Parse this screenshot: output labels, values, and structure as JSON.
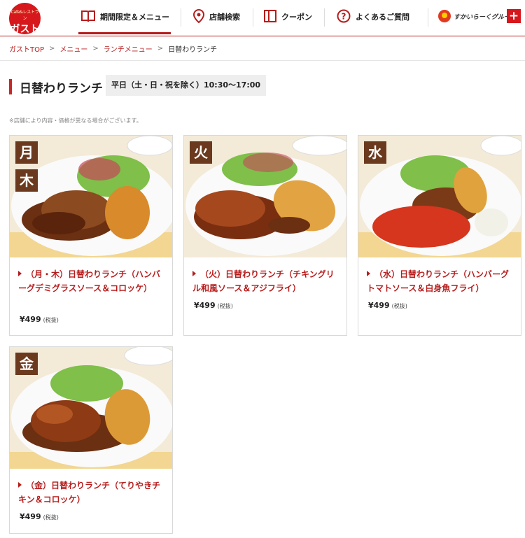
{
  "header": {
    "logo_sub": "Cafe&レストラン",
    "logo_main": "ガスト",
    "nav": [
      {
        "label": "期間限定＆メニュー",
        "icon": "book-icon"
      },
      {
        "label": "店舗検索",
        "icon": "map-pin-icon"
      },
      {
        "label": "クーポン",
        "icon": "coupon-icon"
      },
      {
        "label": "よくあるご質問",
        "icon": "question-icon"
      }
    ],
    "group_logo": "すかいらーくグループ",
    "plus_label": "+"
  },
  "breadcrumb": [
    "ガストTOP",
    "メニュー",
    "ランチメニュー",
    "日替わりランチ"
  ],
  "breadcrumb_sep": ">",
  "page": {
    "title": "日替わりランチ",
    "hours": "平日（土・日・祝を除く）10:30〜17:00",
    "notice": "※店舗により内容・価格が異なる場合がございます。"
  },
  "items": [
    {
      "days": [
        "月",
        "木"
      ],
      "name": "（月・木）日替わりランチ（ハンバーグデミグラスソース＆コロッケ）",
      "price": "¥499",
      "tax": "(税抜)"
    },
    {
      "days": [
        "火"
      ],
      "name": "（火）日替わりランチ（チキングリル和風ソース＆アジフライ）",
      "price": "¥499",
      "tax": "(税抜)"
    },
    {
      "days": [
        "水"
      ],
      "name": "（水）日替わりランチ（ハンバーグトマトソース＆白身魚フライ）",
      "price": "¥499",
      "tax": "(税抜)"
    },
    {
      "days": [
        "金"
      ],
      "name": "（金）日替わりランチ（てりやきチキン＆コロッケ）",
      "price": "¥499",
      "tax": "(税抜)"
    }
  ],
  "colors": {
    "brand_red": "#d6181d",
    "accent": "#b71c1c",
    "badge_brown": "#6b3a1e"
  }
}
